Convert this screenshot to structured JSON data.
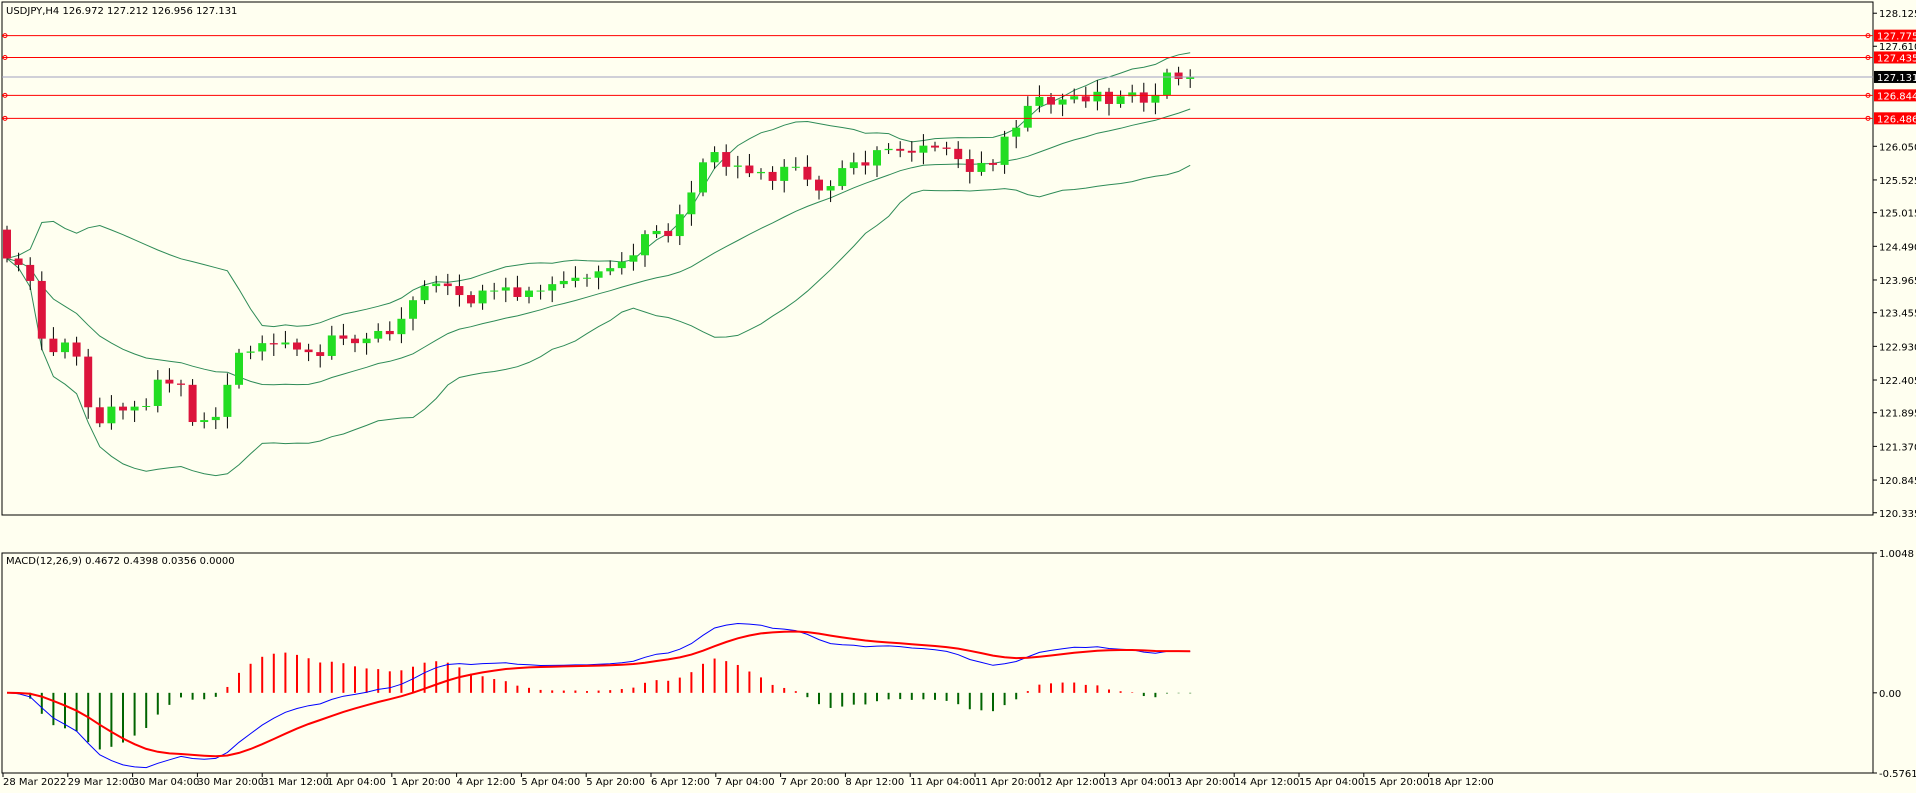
{
  "symbol_info": "USDJPY,H4  126.972 127.212 126.956 127.131",
  "indicator_info": "MACD(12,26,9) 0.4672 0.4398 0.0356 0.0000",
  "colors": {
    "background": "#fffff0",
    "bull": "#22dd22",
    "bear": "#dc143c",
    "bands": "#2e8b57",
    "level": "#ff0000",
    "macd_main": "#0000ff",
    "macd_signal": "#ff0000",
    "hist_pos": "#ff0000",
    "hist_neg": "#006400"
  },
  "chart_data": [
    {
      "type": "candlestick",
      "title": "USDJPY,H4",
      "price_axis_ticks": [
        "128.125",
        "127.610",
        "126.050",
        "125.525",
        "125.015",
        "124.490",
        "123.965",
        "123.455",
        "122.930",
        "122.405",
        "121.895",
        "121.370",
        "120.845",
        "120.335"
      ],
      "ylim": [
        120.3,
        128.3
      ],
      "time_labels": [
        "28 Mar 2022",
        "29 Mar 12:00",
        "30 Mar 04:00",
        "30 Mar 20:00",
        "31 Mar 12:00",
        "1 Apr 04:00",
        "1 Apr 20:00",
        "4 Apr 12:00",
        "5 Apr 04:00",
        "5 Apr 20:00",
        "6 Apr 12:00",
        "7 Apr 04:00",
        "7 Apr 20:00",
        "8 Apr 12:00",
        "11 Apr 04:00",
        "11 Apr 20:00",
        "12 Apr 12:00",
        "13 Apr 04:00",
        "13 Apr 20:00",
        "14 Apr 12:00",
        "15 Apr 04:00",
        "15 Apr 20:00",
        "18 Apr 12:00"
      ],
      "price_levels": [
        127.775,
        127.435,
        126.844,
        126.486
      ],
      "current_price": 127.131,
      "closes": [
        124.3,
        124.2,
        123.95,
        123.05,
        122.84,
        122.99,
        122.77,
        121.98,
        121.73,
        121.99,
        121.93,
        121.99,
        122.0,
        122.41,
        122.35,
        122.33,
        121.75,
        121.78,
        121.83,
        122.33,
        122.83,
        122.85,
        122.98,
        122.96,
        122.99,
        122.88,
        122.84,
        122.78,
        123.1,
        123.05,
        122.98,
        123.05,
        123.17,
        123.12,
        123.36,
        123.65,
        123.87,
        123.91,
        123.87,
        123.73,
        123.6,
        123.8,
        123.8,
        123.85,
        123.7,
        123.8,
        123.8,
        123.9,
        123.95,
        124.0,
        124.0,
        124.1,
        124.15,
        124.25,
        124.35,
        124.68,
        124.73,
        124.65,
        124.99,
        125.33,
        125.8,
        125.96,
        125.73,
        125.75,
        125.63,
        125.65,
        125.51,
        125.73,
        125.73,
        125.53,
        125.36,
        125.43,
        125.71,
        125.8,
        125.75,
        125.99,
        126.01,
        125.98,
        125.95,
        126.06,
        126.03,
        126.01,
        125.85,
        125.65,
        125.79,
        125.76,
        126.2,
        126.34,
        126.68,
        126.82,
        126.7,
        126.78,
        126.83,
        126.75,
        126.9,
        126.71,
        126.83,
        126.89,
        126.73,
        126.85,
        127.2,
        127.1,
        127.131
      ],
      "bollinger": {
        "period": 20
      },
      "macd": {
        "params": "MACD(12,26,9)",
        "value_axis_ticks": [
          "1.0048",
          "0.00",
          "-0.5761"
        ],
        "values": [
          0.4672,
          0.4398,
          0.0356,
          0.0
        ]
      }
    }
  ]
}
